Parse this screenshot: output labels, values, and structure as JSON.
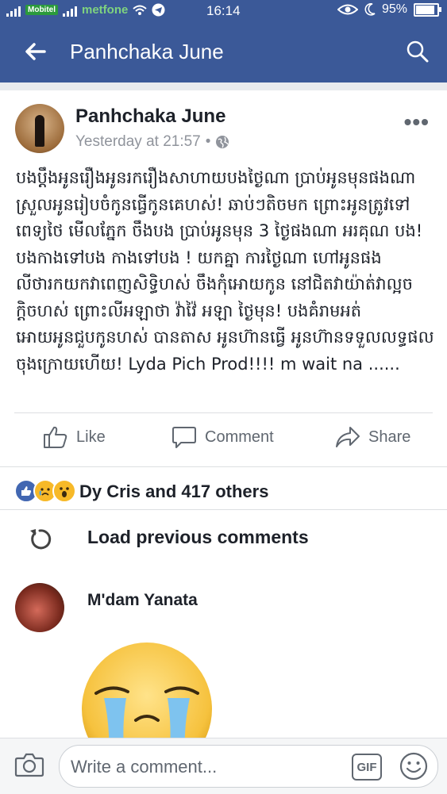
{
  "status_bar": {
    "carrier1": "Mobitel",
    "carrier2": "metfone",
    "time": "16:14",
    "battery": "95%",
    "battery_level": 0.95
  },
  "header": {
    "title": "Panhchaka June",
    "back_icon": "back-arrow-icon",
    "search_icon": "search-icon"
  },
  "post": {
    "author": "Panhchaka June",
    "timestamp": "Yesterday at 21:57",
    "separator": "•",
    "privacy_icon": "globe-icon",
    "more": "•••",
    "text": "បងប្ដឹងអូនរឿងអូនរករឿងសាហាយបងថ្ងៃណា ប្រាប់អូនមុនផងណា ស្រួលអូនរៀបចំកូនធ្វើកូនគេហស់! ឆាប់ៗតិចមក ព្រោះអូនត្រូវទៅពេទ្យថៃ មើលភ្នែក  ចឹងបង ប្រាប់អូនមុន 3 ថ្ងៃផងណា អរគុណ បង!  បងកាងទៅបង កាងទៅបង ! យកគ្នា ការថ្ងៃណា ហៅអូនផង លីថារកយកវាពេញសិទ្ធិហស់ ចឹងកុំអោយកូន នៅជិតវាយ៉ាត់វាល្អចក្តិចហស់ ព្រោះលីអឡាថា វ៉ាវ៉ៃ អឡា ថ្ងៃមុន!  បងគំរាមអត់អោយអូនជួបកូនហស់ បានតាស អូនហ៊ានធ្វើ អូនហ៊ានទទួលលទ្ធផលចុងក្រោយហើយ!  Lyda Pich Prod!!!! m wait na ......"
  },
  "actions": {
    "like": "Like",
    "comment": "Comment",
    "share": "Share"
  },
  "reactions": {
    "icons": [
      "like-reaction-icon",
      "sad-reaction-icon",
      "wow-reaction-icon"
    ],
    "summary": "Dy Cris and 417 others"
  },
  "comments": {
    "load_previous": "Load previous comments",
    "items": [
      {
        "author": "M'dam Yanata",
        "sticker": "crying-face-sticker"
      }
    ]
  },
  "composer": {
    "placeholder": "Write a comment...",
    "gif_label": "GIF"
  },
  "colors": {
    "brand": "#3b5998",
    "like_blue": "#4267b2",
    "text": "#1d2129",
    "muted": "#90949c"
  }
}
